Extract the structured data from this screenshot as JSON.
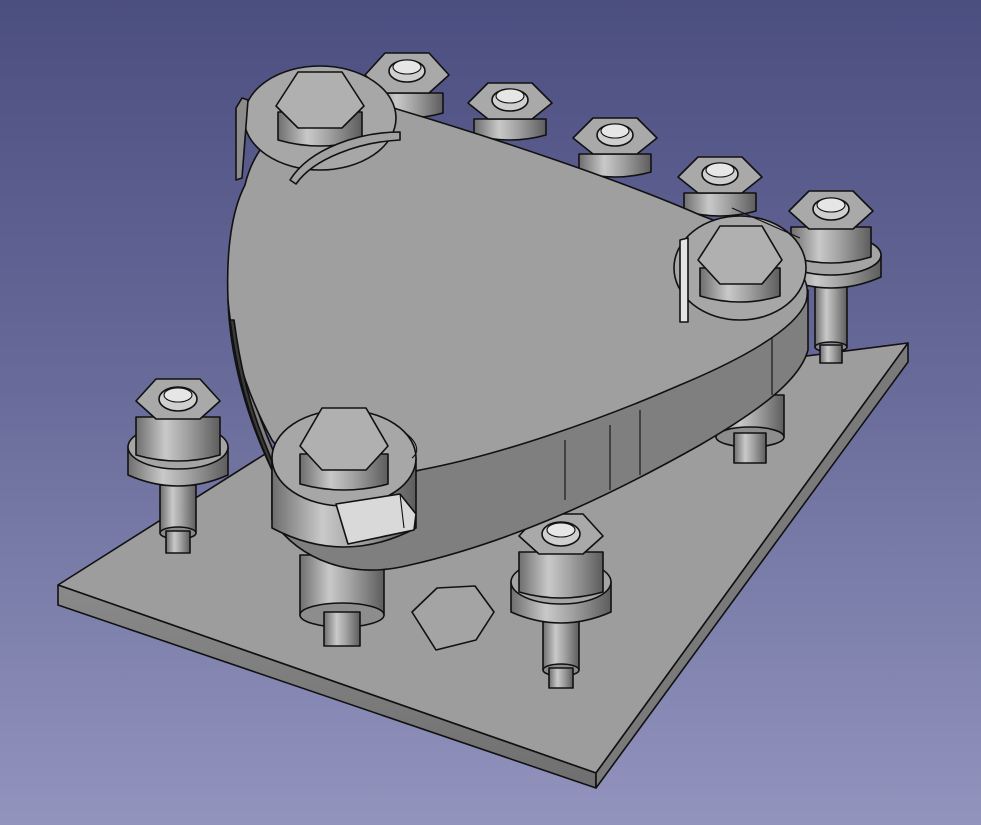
{
  "app": "FreeCAD",
  "view": {
    "type": "3d-viewport",
    "background_top": "#4b4e80",
    "background_bottom": "#9294be",
    "shading": "flat-lines"
  },
  "model": {
    "parts": [
      "base-plate",
      "clamp-body",
      "clamp-bolt",
      "bolt-with-washer-and-nut",
      "hexagonal-cutout"
    ],
    "face_color": "#9c9c9c",
    "edge_color": "#111111",
    "counts": {
      "outer_nuts": 7,
      "clamp_bolts": 3
    }
  }
}
